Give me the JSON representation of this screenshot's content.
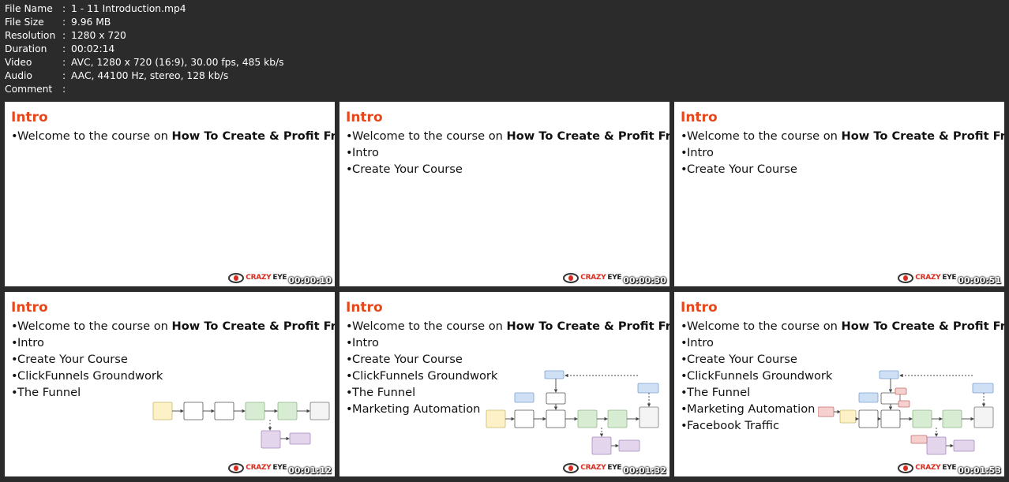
{
  "file_info": [
    {
      "key": "File Name",
      "value": "1 - 11 Introduction.mp4"
    },
    {
      "key": "File Size",
      "value": "9.96 MB"
    },
    {
      "key": "Resolution",
      "value": "1280 x 720"
    },
    {
      "key": "Duration",
      "value": "00:02:14"
    },
    {
      "key": "Video",
      "value": "AVC, 1280 x 720 (16:9), 30.00 fps, 485 kb/s"
    },
    {
      "key": "Audio",
      "value": "AAC, 44100 Hz, stereo, 128 kb/s"
    },
    {
      "key": "Comment",
      "value": ""
    }
  ],
  "separator": ":",
  "brand": {
    "part1": "CRAZY",
    "part2": "EYE"
  },
  "slides": [
    {
      "title": "Intro",
      "intro_prefix": "Welcome to the course on ",
      "intro_bold": "How To Create & Profit From “Affordable” Courses",
      "intro_suffix": "!",
      "bullets": [],
      "timestamp": "00:00:10"
    },
    {
      "title": "Intro",
      "intro_prefix": "Welcome to the course on ",
      "intro_bold": "How To Create & Profit From “Affordable” Courses",
      "intro_suffix": "!",
      "bullets": [
        "Intro",
        "Create Your Course"
      ],
      "timestamp": "00:00:30"
    },
    {
      "title": "Intro",
      "intro_prefix": "Welcome to the course on ",
      "intro_bold": "How To Create & Profit From “Affordable” Courses",
      "intro_suffix": "!",
      "bullets": [
        "Intro",
        "Create Your Course"
      ],
      "timestamp": "00:00:51"
    },
    {
      "title": "Intro",
      "intro_prefix": "Welcome to the course on ",
      "intro_bold": "How To Create & Profit From “Affordable” Courses",
      "intro_suffix": "!",
      "bullets": [
        "Intro",
        "Create Your Course",
        "ClickFunnels Groundwork",
        "The Funnel"
      ],
      "timestamp": "00:01:12"
    },
    {
      "title": "Intro",
      "intro_prefix": "Welcome to the course on ",
      "intro_bold": "How To Create & Profit From “Affordable” Courses",
      "intro_suffix": "!",
      "bullets": [
        "Intro",
        "Create Your Course",
        "ClickFunnels Groundwork",
        "The Funnel",
        "Marketing Automation"
      ],
      "timestamp": "00:01:32"
    },
    {
      "title": "Intro",
      "intro_prefix": "Welcome to the course on ",
      "intro_bold": "How To Create & Profit From “Affordable” Courses",
      "intro_suffix": "!",
      "bullets": [
        "Intro",
        "Create Your Course",
        "ClickFunnels Groundwork",
        "The Funnel",
        "Marketing Automation",
        "Facebook Traffic"
      ],
      "timestamp": "00:01:53"
    }
  ],
  "colors": {
    "title": "#e5481c",
    "yellow_box": "#fdf1c8",
    "green_box": "#d7ecd2",
    "purple_box": "#e3d5ec",
    "blue_box": "#cfe0f5",
    "red_box": "#f6cfcf"
  }
}
